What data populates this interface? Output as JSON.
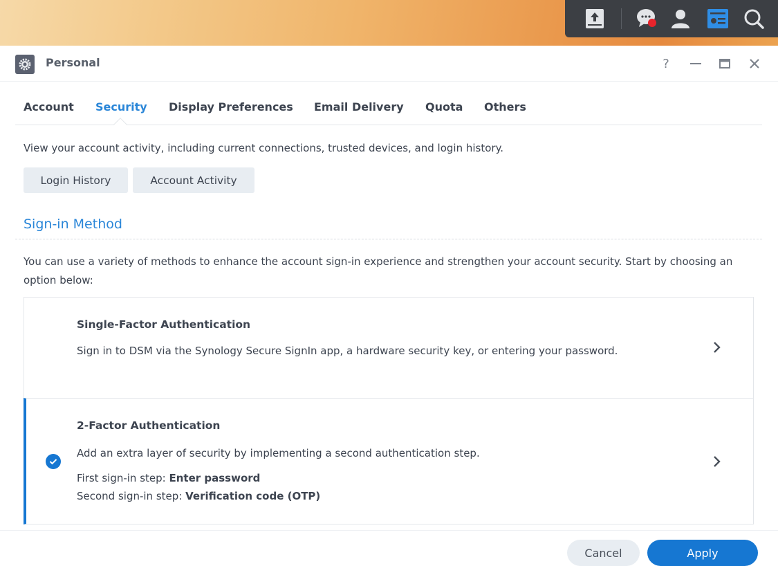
{
  "taskbar": {
    "icons": [
      "upload-icon",
      "notification-icon",
      "user-icon",
      "widgets-icon",
      "search-icon"
    ],
    "notification_badge_color": "#e8242c",
    "active_icon_color": "#2f8ee6"
  },
  "window": {
    "title": "Personal",
    "controls": {
      "help": "?",
      "minimize": "—",
      "maximize": "▭",
      "close": "✕"
    }
  },
  "tabs": [
    {
      "label": "Account",
      "active": false
    },
    {
      "label": "Security",
      "active": true
    },
    {
      "label": "Display Preferences",
      "active": false
    },
    {
      "label": "Email Delivery",
      "active": false
    },
    {
      "label": "Quota",
      "active": false
    },
    {
      "label": "Others",
      "active": false
    }
  ],
  "activity": {
    "description": "View your account activity, including current connections, trusted devices, and login history.",
    "buttons": {
      "login_history": "Login History",
      "account_activity": "Account Activity"
    }
  },
  "sign_in": {
    "section_title": "Sign-in Method",
    "intro": "You can use a variety of methods to enhance the account sign-in experience and strengthen your account security. Start by choosing an option below:",
    "options": [
      {
        "title": "Single-Factor Authentication",
        "description": "Sign in to DSM via the Synology Secure SignIn app, a hardware security key, or entering your password.",
        "selected": false
      },
      {
        "title": "2-Factor Authentication",
        "description": "Add an extra layer of security by implementing a second authentication step.",
        "first_step_label": "First sign-in step: ",
        "first_step_value": "Enter password",
        "second_step_label": "Second sign-in step: ",
        "second_step_value": "Verification code (OTP)",
        "selected": true
      }
    ]
  },
  "footer": {
    "cancel": "Cancel",
    "apply": "Apply"
  },
  "colors": {
    "accent": "#1677d2",
    "link": "#2a86d8",
    "text": "#3d4450"
  }
}
